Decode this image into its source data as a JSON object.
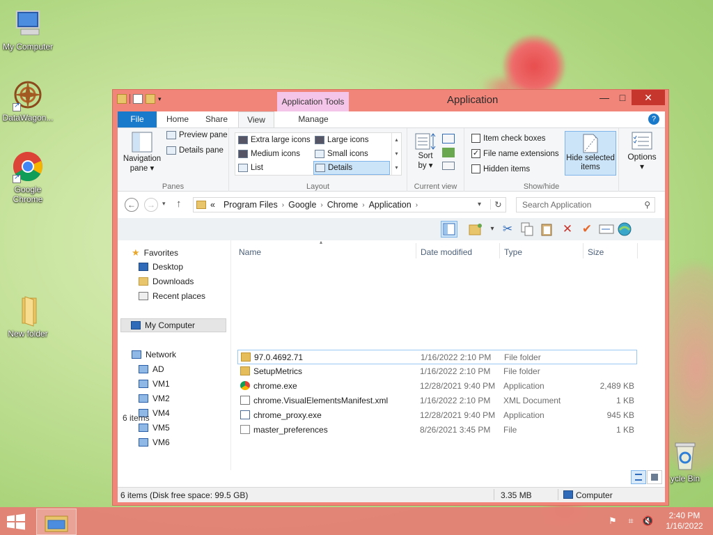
{
  "desktop": {
    "icons": [
      {
        "label": "My Computer",
        "icon": "my-computer-icon"
      },
      {
        "label": "DataWagon...",
        "icon": "datawagon-icon"
      },
      {
        "label": "Google Chrome",
        "icon": "chrome-icon"
      },
      {
        "label": "New folder",
        "icon": "folder-icon"
      },
      {
        "label": "ycle Bin",
        "icon": "recycle-bin-icon"
      }
    ]
  },
  "window": {
    "title": "Application",
    "context_tab": "Application Tools",
    "controls": {
      "minimize": "—",
      "maximize": "□",
      "close": "✕"
    },
    "help": "?"
  },
  "ribbon_tabs": [
    {
      "label": "File"
    },
    {
      "label": "Home"
    },
    {
      "label": "Share"
    },
    {
      "label": "View"
    },
    {
      "label": "Manage"
    }
  ],
  "ribbon": {
    "panes": {
      "label": "Panes",
      "navigation_pane": "Navigation pane",
      "preview_pane": "Preview pane",
      "details_pane": "Details pane"
    },
    "layout": {
      "label": "Layout",
      "options": [
        "Extra large icons",
        "Large icons",
        "Medium icons",
        "Small icons",
        "List",
        "Details"
      ],
      "selected": "Details"
    },
    "current_view": {
      "label": "Current view",
      "sort_by": "Sort by"
    },
    "show_hide": {
      "label": "Show/hide",
      "item_check_boxes": {
        "label": "Item check boxes",
        "checked": false
      },
      "file_name_extensions": {
        "label": "File name extensions",
        "checked": true
      },
      "hidden_items": {
        "label": "Hidden items",
        "checked": false
      },
      "hide_selected_items": "Hide selected items"
    },
    "options": {
      "label": "Options"
    }
  },
  "address": {
    "crumbs": [
      "Program Files",
      "Google",
      "Chrome",
      "Application"
    ],
    "prefix": "«",
    "search_placeholder": "Search Application"
  },
  "nav_pane": {
    "favorites": {
      "label": "Favorites",
      "items": [
        "Desktop",
        "Downloads",
        "Recent places"
      ]
    },
    "my_computer": "My Computer",
    "network": {
      "label": "Network",
      "items": [
        "AD",
        "VM1",
        "VM2",
        "VM4",
        "VM5",
        "VM6"
      ]
    }
  },
  "file_list": {
    "columns": [
      "Name",
      "Date modified",
      "Type",
      "Size"
    ],
    "rows": [
      {
        "name": "97.0.4692.71",
        "date": "1/16/2022 2:10 PM",
        "type": "File folder",
        "size": "",
        "icon": "folder-icon"
      },
      {
        "name": "SetupMetrics",
        "date": "1/16/2022 2:10 PM",
        "type": "File folder",
        "size": "",
        "icon": "folder-icon"
      },
      {
        "name": "chrome.exe",
        "date": "12/28/2021 9:40 PM",
        "type": "Application",
        "size": "2,489 KB",
        "icon": "chrome-icon"
      },
      {
        "name": "chrome.VisualElementsManifest.xml",
        "date": "1/16/2022 2:10 PM",
        "type": "XML Document",
        "size": "1 KB",
        "icon": "xml-file-icon"
      },
      {
        "name": "chrome_proxy.exe",
        "date": "12/28/2021 9:40 PM",
        "type": "Application",
        "size": "945 KB",
        "icon": "application-icon"
      },
      {
        "name": "master_preferences",
        "date": "8/26/2021 3:45 PM",
        "type": "File",
        "size": "1 KB",
        "icon": "file-icon"
      }
    ]
  },
  "items_count": "6 items",
  "status": {
    "left": "6 items (Disk free space: 99.5 GB)",
    "size": "3.35 MB",
    "location": "Computer"
  },
  "taskbar": {
    "time": "2:40 PM",
    "date": "1/16/2022"
  }
}
